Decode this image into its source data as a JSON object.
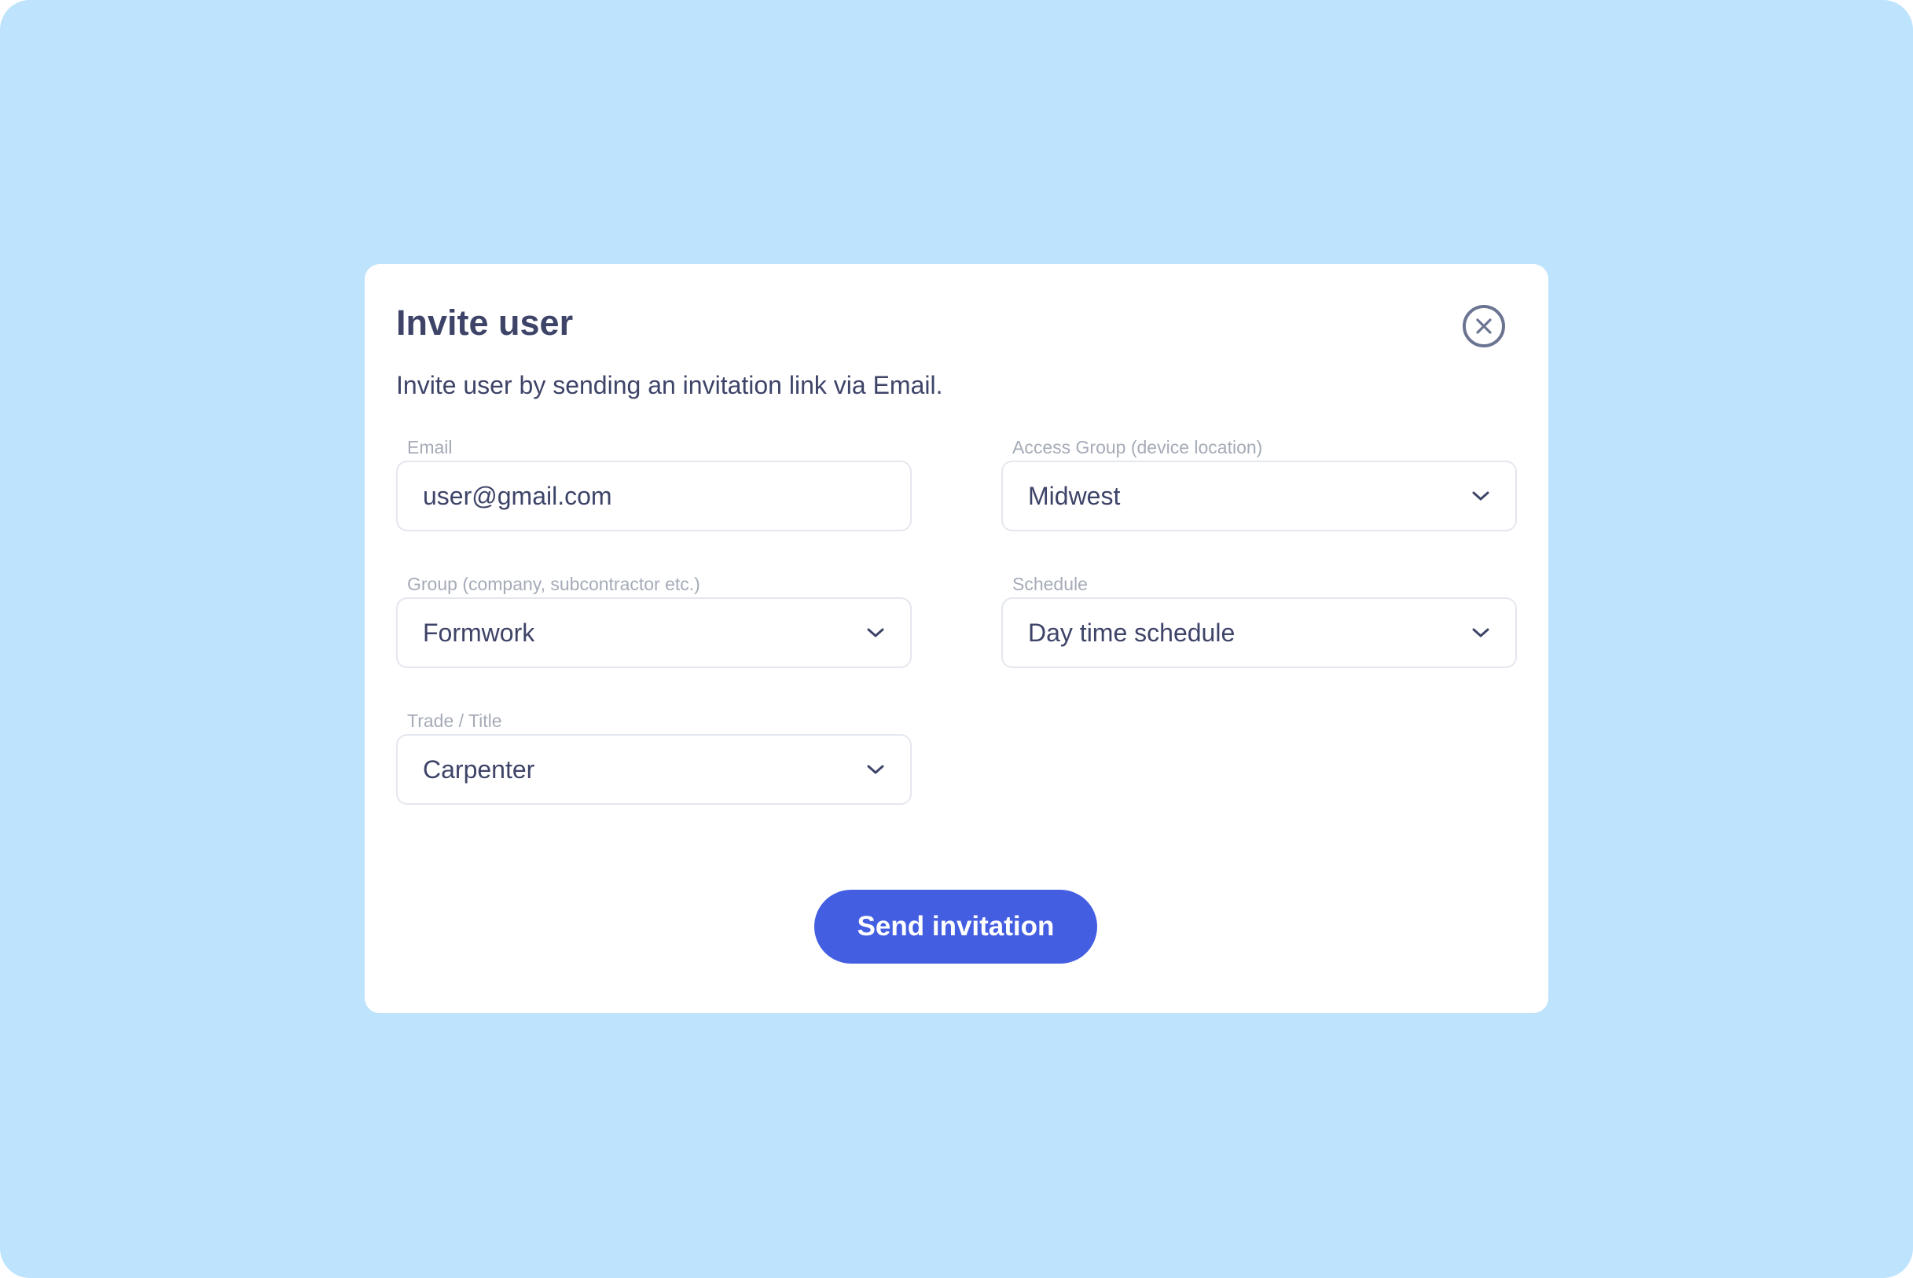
{
  "dialog": {
    "title": "Invite user",
    "subtitle": "Invite user by sending an invitation link via Email.",
    "close_icon": "close-icon"
  },
  "fields": {
    "email": {
      "label": "Email",
      "value": "user@gmail.com"
    },
    "access_group": {
      "label": "Access Group (device location)",
      "value": "Midwest",
      "icon": "chevron-down-icon"
    },
    "group": {
      "label": "Group (company, subcontractor etc.)",
      "value": "Formwork",
      "icon": "chevron-down-icon"
    },
    "schedule": {
      "label": "Schedule",
      "value": "Day time schedule",
      "icon": "chevron-down-icon"
    },
    "trade": {
      "label": "Trade / Title",
      "value": "Carpenter",
      "icon": "chevron-down-icon"
    }
  },
  "actions": {
    "send_label": "Send invitation"
  },
  "colors": {
    "background": "#bde3fd",
    "surface": "#ffffff",
    "text_primary": "#3e4468",
    "label_muted": "#a5abb7",
    "field_border": "#e4e7ee",
    "accent": "#445ee2",
    "close_icon_stroke": "#6b7591"
  }
}
